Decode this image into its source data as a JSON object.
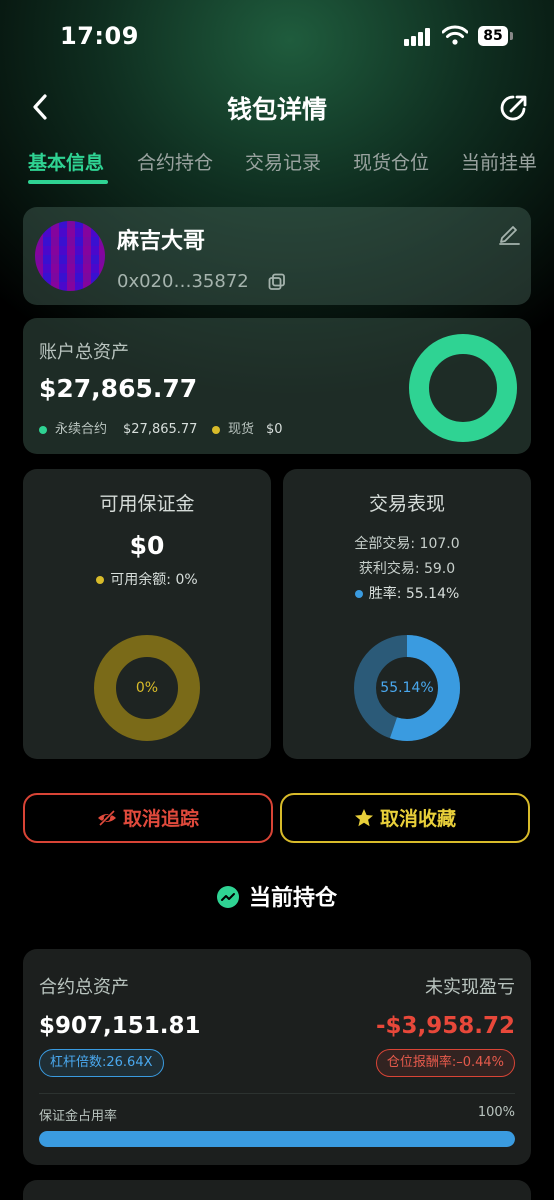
{
  "status_bar": {
    "time": "17:09",
    "battery": "85"
  },
  "header": {
    "title": "钱包详情",
    "icons": [
      "chevron-left-icon",
      "share-icon"
    ]
  },
  "tabs": [
    {
      "label": "基本信息",
      "active": true
    },
    {
      "label": "合约持仓",
      "active": false
    },
    {
      "label": "交易记录",
      "active": false
    },
    {
      "label": "现货仓位",
      "active": false
    },
    {
      "label": "当前挂单",
      "active": false
    }
  ],
  "profile": {
    "name": "麻吉大哥",
    "address": "0x020…35872"
  },
  "assets": {
    "label": "账户总资产",
    "value": "$27,865.77",
    "legend": [
      {
        "label": "永续合约",
        "value": "$27,865.77",
        "color": "#2fd393"
      },
      {
        "label": "现货",
        "value": "$0",
        "color": "#d8bb2a"
      }
    ],
    "perp_share": 1.0
  },
  "margin": {
    "title": "可用保证金",
    "value": "$0",
    "sub_label": "可用余额:",
    "sub_value": "0%",
    "donut_label": "0%",
    "fraction": 0,
    "color": "#d8bb2a"
  },
  "trading": {
    "title": "交易表现",
    "total_trades": "全部交易: 107.0",
    "win_trades": "获利交易: 59.0",
    "win_rate_label": "胜率:",
    "win_rate_value": "55.14%",
    "donut_label": "55.14%",
    "fraction": 0.5514,
    "color": "#3a9be0"
  },
  "actions": {
    "untrack": "取消追踪",
    "unfavorite": "取消收藏"
  },
  "positions": {
    "section_title": "当前持仓",
    "total_label": "合约总资产",
    "total_value": "$907,151.81",
    "pnl_label": "未实现盈亏",
    "pnl_value": "-$3,958.72",
    "leverage": "杠杆倍数:26.64X",
    "roi": "仓位报酬率:–0.44%",
    "margin_usage_label": "保证金占用率",
    "margin_usage_pct": "100%",
    "margin_usage_fraction": 1.0
  }
}
